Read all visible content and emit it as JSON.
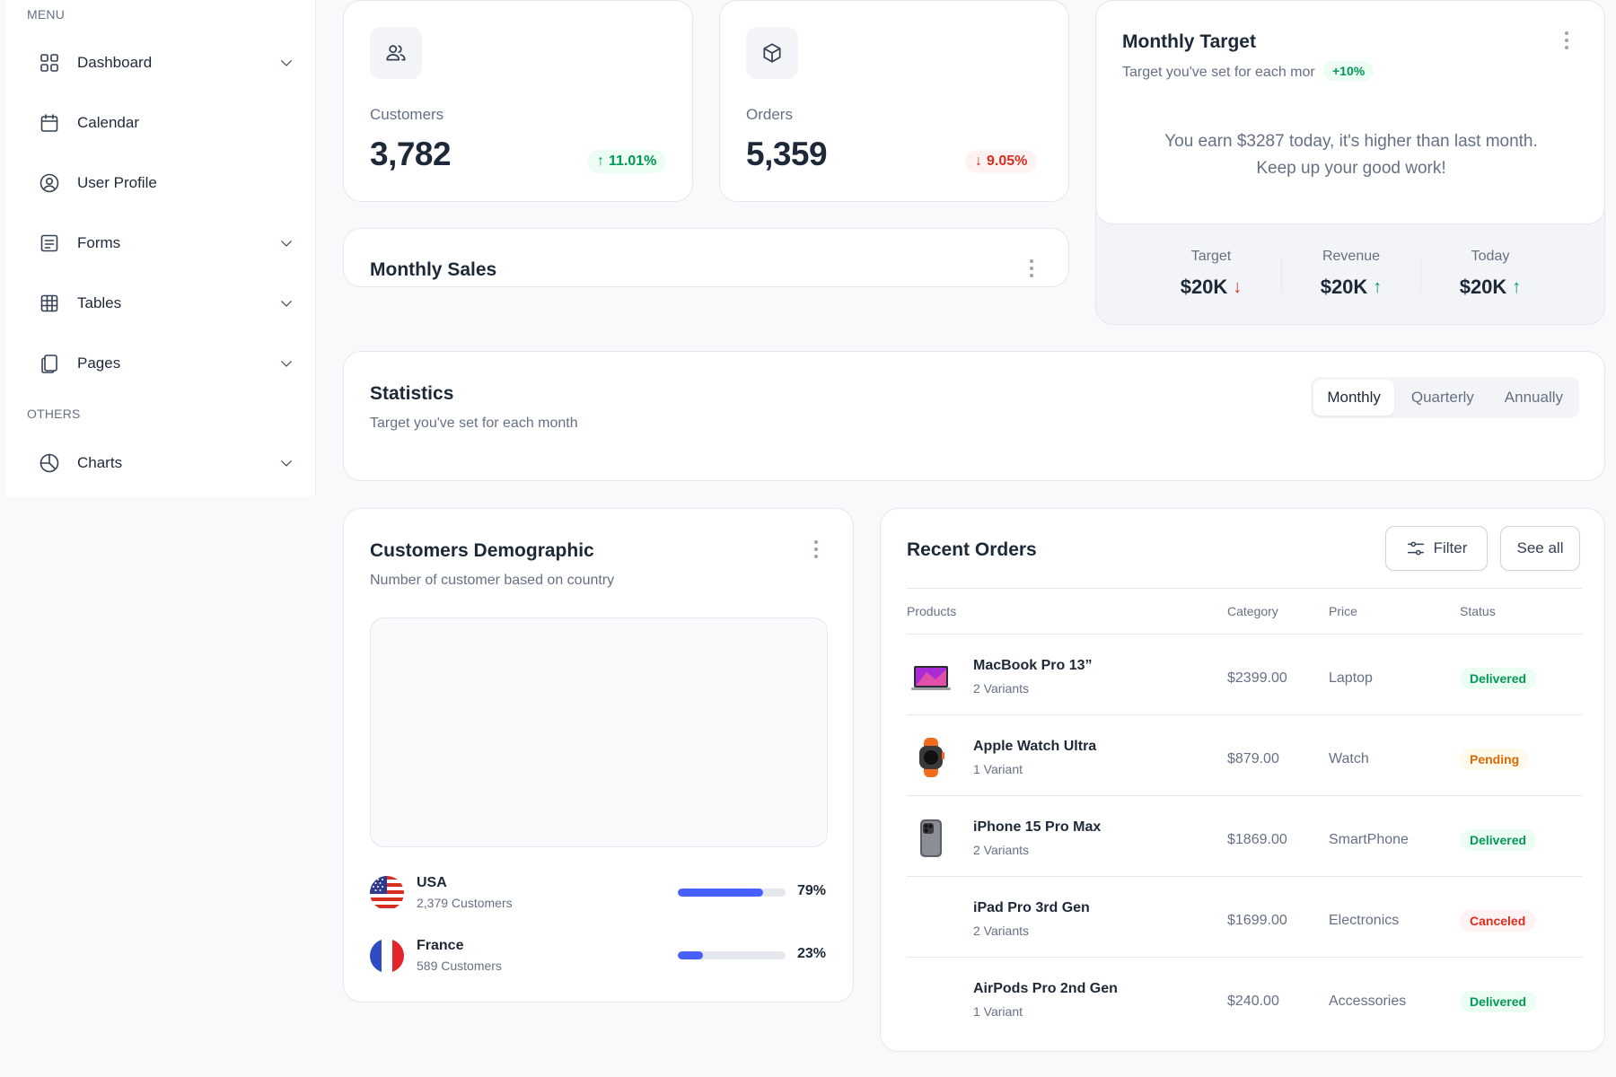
{
  "sidebar": {
    "menu_label": "MENU",
    "others_label": "OTHERS",
    "items": [
      {
        "label": "Dashboard",
        "icon": "grid-icon"
      },
      {
        "label": "Calendar",
        "icon": "calendar-icon"
      },
      {
        "label": "User Profile",
        "icon": "user-circle-icon"
      },
      {
        "label": "Forms",
        "icon": "list-icon"
      },
      {
        "label": "Tables",
        "icon": "table-icon"
      },
      {
        "label": "Pages",
        "icon": "pages-icon"
      }
    ],
    "others": [
      {
        "label": "Charts",
        "icon": "pie-chart-icon"
      }
    ]
  },
  "metrics": {
    "customers": {
      "label": "Customers",
      "value": "3,782",
      "change": "11.01%",
      "direction": "up"
    },
    "orders": {
      "label": "Orders",
      "value": "5,359",
      "change": "9.05%",
      "direction": "down"
    }
  },
  "monthly_sales": {
    "title": "Monthly Sales"
  },
  "monthly_target": {
    "title": "Monthly Target",
    "subtitle": "Target you've set for each mor",
    "badge": "+10%",
    "message_line1": "You earn $3287 today, it's higher than last month.",
    "message_line2": "Keep up your good work!",
    "stats": [
      {
        "label": "Target",
        "value": "$20K",
        "direction": "down"
      },
      {
        "label": "Revenue",
        "value": "$20K",
        "direction": "up"
      },
      {
        "label": "Today",
        "value": "$20K",
        "direction": "up"
      }
    ]
  },
  "statistics": {
    "title": "Statistics",
    "subtitle": "Target you've set for each month",
    "tabs": [
      "Monthly",
      "Quarterly",
      "Annually"
    ],
    "active_tab": "Monthly"
  },
  "demographic": {
    "title": "Customers Demographic",
    "subtitle": "Number of customer based on country",
    "countries": [
      {
        "name": "USA",
        "customers": "2,379 Customers",
        "percent": "79%",
        "fill": 0.79
      },
      {
        "name": "France",
        "customers": "589 Customers",
        "percent": "23%",
        "fill": 0.23
      }
    ]
  },
  "recent_orders": {
    "title": "Recent Orders",
    "filter_label": "Filter",
    "see_all_label": "See all",
    "columns": [
      "Products",
      "Category",
      "Price",
      "Status"
    ],
    "rows": [
      {
        "name": "MacBook Pro 13”",
        "variants": "2 Variants",
        "col2": "$2399.00",
        "col3": "Laptop",
        "status": "Delivered",
        "status_type": "delivered",
        "image": "laptop"
      },
      {
        "name": "Apple Watch Ultra",
        "variants": "1 Variant",
        "col2": "$879.00",
        "col3": "Watch",
        "status": "Pending",
        "status_type": "pending",
        "image": "watch"
      },
      {
        "name": "iPhone 15 Pro Max",
        "variants": "2 Variants",
        "col2": "$1869.00",
        "col3": "SmartPhone",
        "status": "Delivered",
        "status_type": "delivered",
        "image": "phone"
      },
      {
        "name": "iPad Pro 3rd Gen",
        "variants": "2 Variants",
        "col2": "$1699.00",
        "col3": "Electronics",
        "status": "Canceled",
        "status_type": "canceled",
        "image": "none"
      },
      {
        "name": "AirPods Pro 2nd Gen",
        "variants": "1 Variant",
        "col2": "$240.00",
        "col3": "Accessories",
        "status": "Delivered",
        "status_type": "delivered",
        "image": "none"
      }
    ]
  },
  "colors": {
    "brand": "#465fff",
    "success": "#039855",
    "error": "#d92d20",
    "warning": "#dc6803"
  }
}
